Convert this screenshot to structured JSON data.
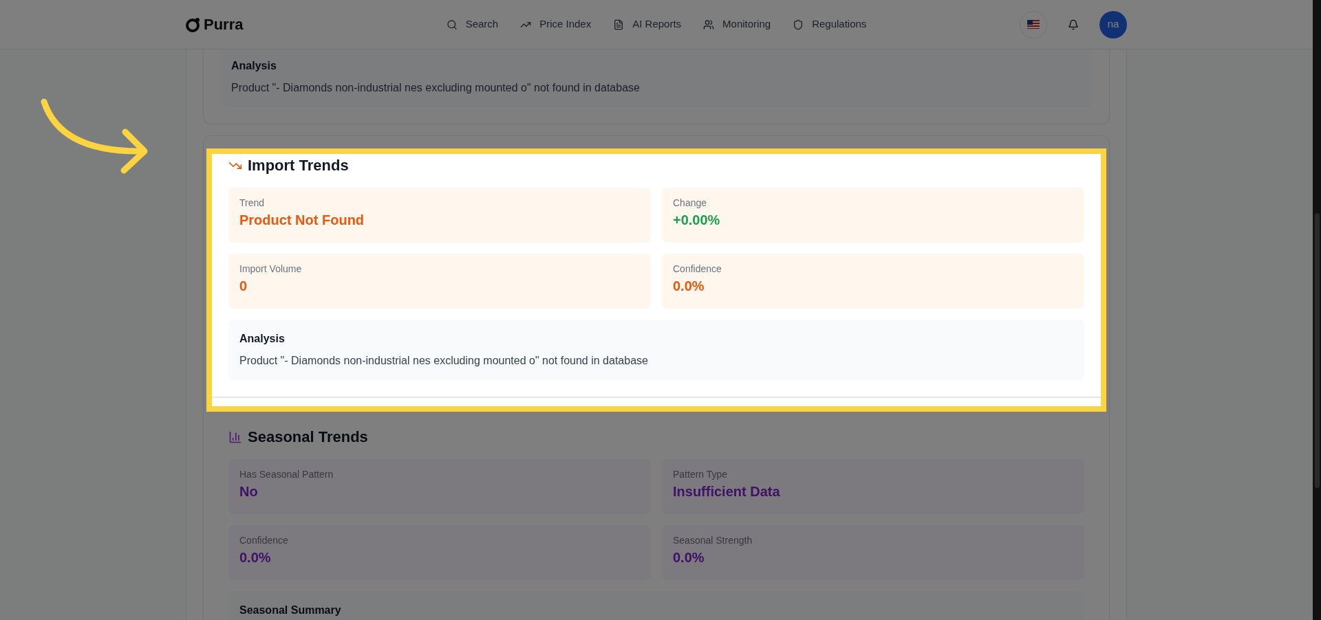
{
  "header": {
    "logo": "Purra",
    "nav": [
      {
        "kind": "search",
        "label": "Search"
      },
      {
        "kind": "price",
        "label": "Price Index"
      },
      {
        "kind": "reports",
        "label": "AI Reports"
      },
      {
        "kind": "monitoring",
        "label": "Monitoring"
      },
      {
        "kind": "regulations",
        "label": "Regulations"
      }
    ],
    "avatar": "na"
  },
  "previous_section": {
    "analysis": {
      "title": "Analysis",
      "text": "Product \"- Diamonds non-industrial nes excluding mounted o\" not found in database"
    }
  },
  "import_trends": {
    "kind": "import",
    "title": "Import Trends",
    "highlighted": true,
    "metrics": [
      {
        "label": "Trend",
        "value": "Product Not Found",
        "color": "#ea580c"
      },
      {
        "label": "Change",
        "value": "+0.00%",
        "color": "#16a34a"
      },
      {
        "label": "Import Volume",
        "value": "0",
        "color": "#ea580c"
      },
      {
        "label": "Confidence",
        "value": "0.0%",
        "color": "#ea580c"
      }
    ],
    "analysis": {
      "title": "Analysis",
      "text": "Product \"- Diamonds non-industrial nes excluding mounted o\" not found in database"
    }
  },
  "seasonal_trends": {
    "kind": "seasonal",
    "title": "Seasonal Trends",
    "highlighted": false,
    "metrics": [
      {
        "label": "Has Seasonal Pattern",
        "value": "No"
      },
      {
        "label": "Pattern Type",
        "value": "Insufficient Data"
      },
      {
        "label": "Confidence",
        "value": "0.0%"
      },
      {
        "label": "Seasonal Strength",
        "value": "0.0%"
      }
    ],
    "summary_title": "Seasonal Summary"
  }
}
